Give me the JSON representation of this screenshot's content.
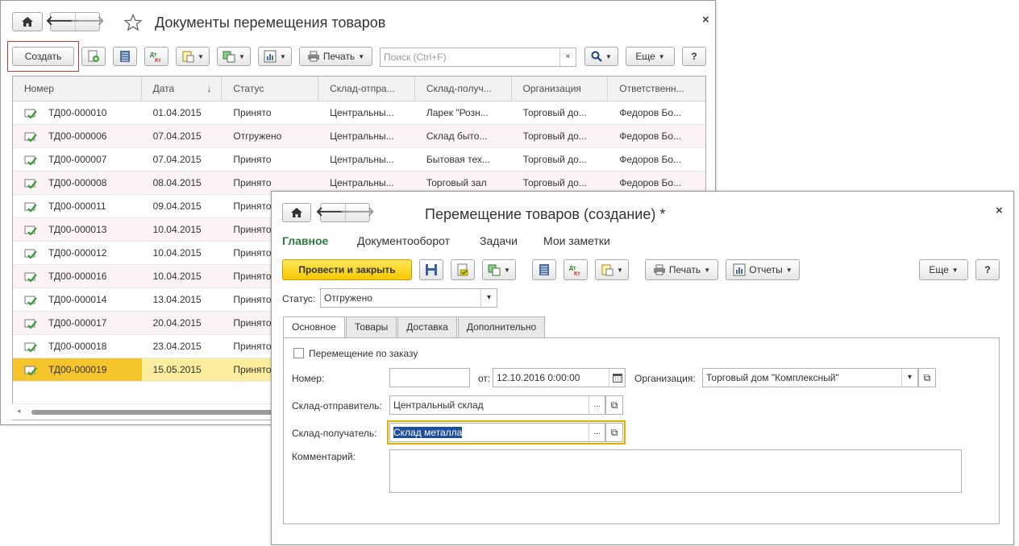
{
  "list_window": {
    "title": "Документы перемещения товаров",
    "close": "×",
    "toolbar": {
      "create_label": "Создать",
      "print_label": "Печать",
      "search_placeholder": "Поиск (Ctrl+F)",
      "search_clear": "×",
      "more_label": "Еще",
      "help_label": "?"
    },
    "columns": [
      "Номер",
      "Дата",
      "Статус",
      "Склад-отпра...",
      "Склад-получ...",
      "Организация",
      "Ответственн..."
    ],
    "sort_indicator": "↓",
    "rows": [
      {
        "number": "ТД00-000010",
        "date": "01.04.2015",
        "status": "Принято",
        "sender": "Центральны...",
        "receiver": "Ларек \"Розн...",
        "org": "Торговый до...",
        "resp": "Федоров Бо..."
      },
      {
        "number": "ТД00-000006",
        "date": "07.04.2015",
        "status": "Отгружено",
        "sender": "Центральны...",
        "receiver": "Склад быто...",
        "org": "Торговый до...",
        "resp": "Федоров Бо..."
      },
      {
        "number": "ТД00-000007",
        "date": "07.04.2015",
        "status": "Принято",
        "sender": "Центральны...",
        "receiver": "Бытовая тех...",
        "org": "Торговый до...",
        "resp": "Федоров Бо..."
      },
      {
        "number": "ТД00-000008",
        "date": "08.04.2015",
        "status": "Принято",
        "sender": "Центральны...",
        "receiver": "Торговый зал",
        "org": "Торговый до...",
        "resp": "Федоров Бо..."
      },
      {
        "number": "ТД00-000011",
        "date": "09.04.2015",
        "status": "Принято",
        "sender": "",
        "receiver": "",
        "org": "",
        "resp": ""
      },
      {
        "number": "ТД00-000013",
        "date": "10.04.2015",
        "status": "Принято",
        "sender": "",
        "receiver": "",
        "org": "",
        "resp": ""
      },
      {
        "number": "ТД00-000012",
        "date": "10.04.2015",
        "status": "Принято",
        "sender": "",
        "receiver": "",
        "org": "",
        "resp": ""
      },
      {
        "number": "ТД00-000016",
        "date": "10.04.2015",
        "status": "Принято",
        "sender": "",
        "receiver": "",
        "org": "",
        "resp": ""
      },
      {
        "number": "ТД00-000014",
        "date": "13.04.2015",
        "status": "Принято",
        "sender": "",
        "receiver": "",
        "org": "",
        "resp": ""
      },
      {
        "number": "ТД00-000017",
        "date": "20.04.2015",
        "status": "Принято",
        "sender": "",
        "receiver": "",
        "org": "",
        "resp": ""
      },
      {
        "number": "ТД00-000018",
        "date": "23.04.2015",
        "status": "Принято",
        "sender": "",
        "receiver": "",
        "org": "",
        "resp": ""
      },
      {
        "number": "ТД00-000019",
        "date": "15.05.2015",
        "status": "Принято",
        "sender": "",
        "receiver": "",
        "org": "",
        "resp": ""
      }
    ]
  },
  "form_window": {
    "title": "Перемещение товаров (создание) *",
    "close": "×",
    "menu": [
      "Главное",
      "Документооборот",
      "Задачи",
      "Мои заметки"
    ],
    "toolbar": {
      "post_close_label": "Провести и закрыть",
      "print_label": "Печать",
      "reports_label": "Отчеты",
      "more_label": "Еще",
      "help_label": "?"
    },
    "status_label": "Статус:",
    "status_value": "Отгружено",
    "tabs": [
      "Основное",
      "Товары",
      "Доставка",
      "Дополнительно"
    ],
    "by_order_label": "Перемещение по заказу",
    "number_label": "Номер:",
    "number_value": "",
    "date_label": "от:",
    "date_value": "12.10.2016  0:00:00",
    "org_label": "Организация:",
    "org_value": "Торговый дом \"Комплексный\"",
    "sender_label": "Склад-отправитель:",
    "sender_value": "Центральный склад",
    "receiver_label": "Склад-получатель:",
    "receiver_value": "Склад металла",
    "comment_label": "Комментарий:",
    "comment_value": "",
    "ellipsis": "...",
    "open_glyph": "⧉",
    "dropdown_glyph": "▾"
  },
  "colors": {
    "selected_row": "#fbed9e",
    "selected_cell": "#f5c52b",
    "alt_row": "#fbf3f6",
    "primary_button": "#f6c800",
    "active_menu": "#2b7a3b",
    "focus_border": "#e2b100"
  }
}
